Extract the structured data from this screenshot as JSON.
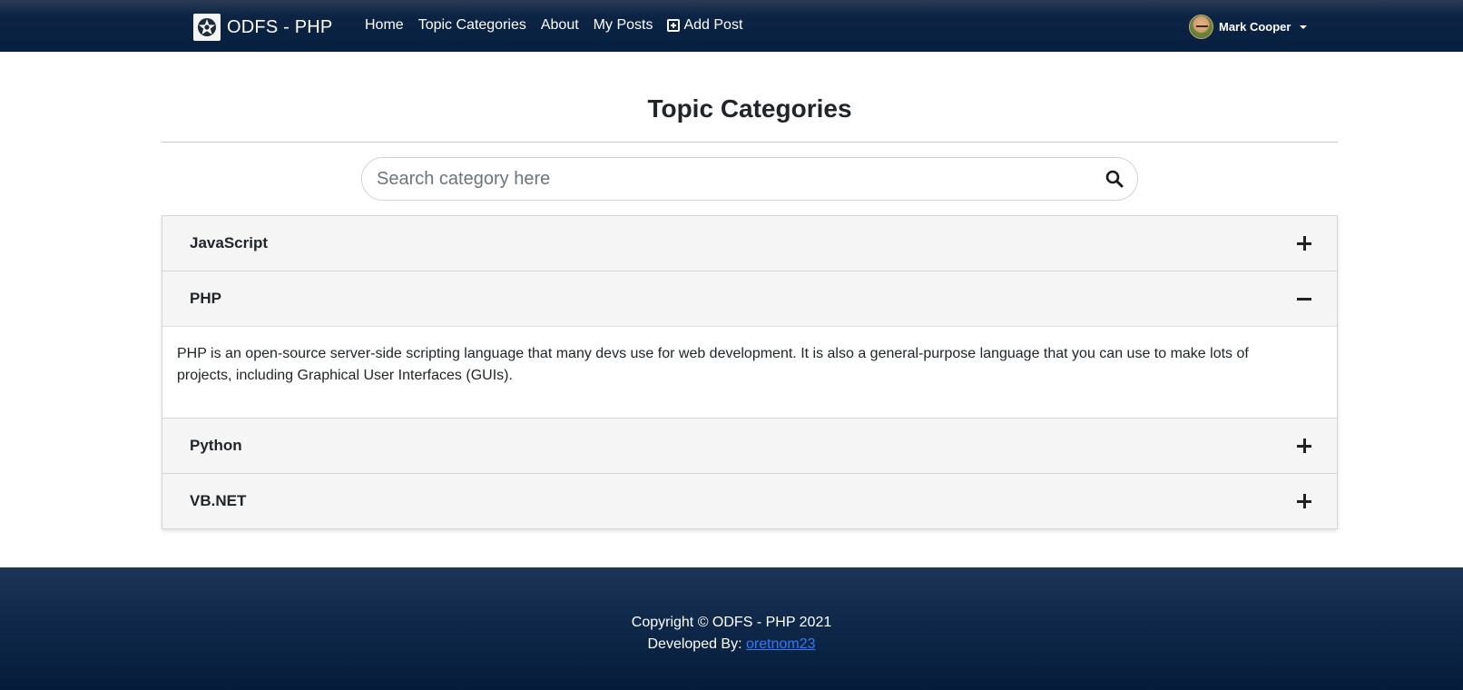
{
  "navbar": {
    "brand_name": "ODFS - PHP",
    "links": [
      {
        "label": "Home"
      },
      {
        "label": "Topic Categories"
      },
      {
        "label": "About"
      },
      {
        "label": "My Posts"
      },
      {
        "label": "Add Post",
        "icon": "plus-square-icon"
      }
    ],
    "user_name": "Mark Cooper"
  },
  "main": {
    "title": "Topic Categories",
    "search": {
      "placeholder": "Search category here",
      "value": "",
      "icon": "search-icon"
    },
    "categories": [
      {
        "title": "JavaScript",
        "expanded": false,
        "icon": "plus-icon"
      },
      {
        "title": "PHP",
        "expanded": true,
        "icon": "minus-icon",
        "description": "PHP is an open-source server-side scripting language that many devs use for web development. It is also a general-purpose language that you can use to make lots of projects, including Graphical User Interfaces (GUIs)."
      },
      {
        "title": "Python",
        "expanded": false,
        "icon": "plus-icon"
      },
      {
        "title": "VB.NET",
        "expanded": false,
        "icon": "plus-icon"
      }
    ]
  },
  "footer": {
    "copyright": "Copyright © ODFS - PHP 2021",
    "developed_by_label": "Developed By:",
    "developer": "oretnom23"
  },
  "colors": {
    "navbar_bg": "#0d2444",
    "footer_bg": "#0e2748",
    "accordion_header_bg": "#f5f5f5",
    "link": "#2f7bff"
  }
}
